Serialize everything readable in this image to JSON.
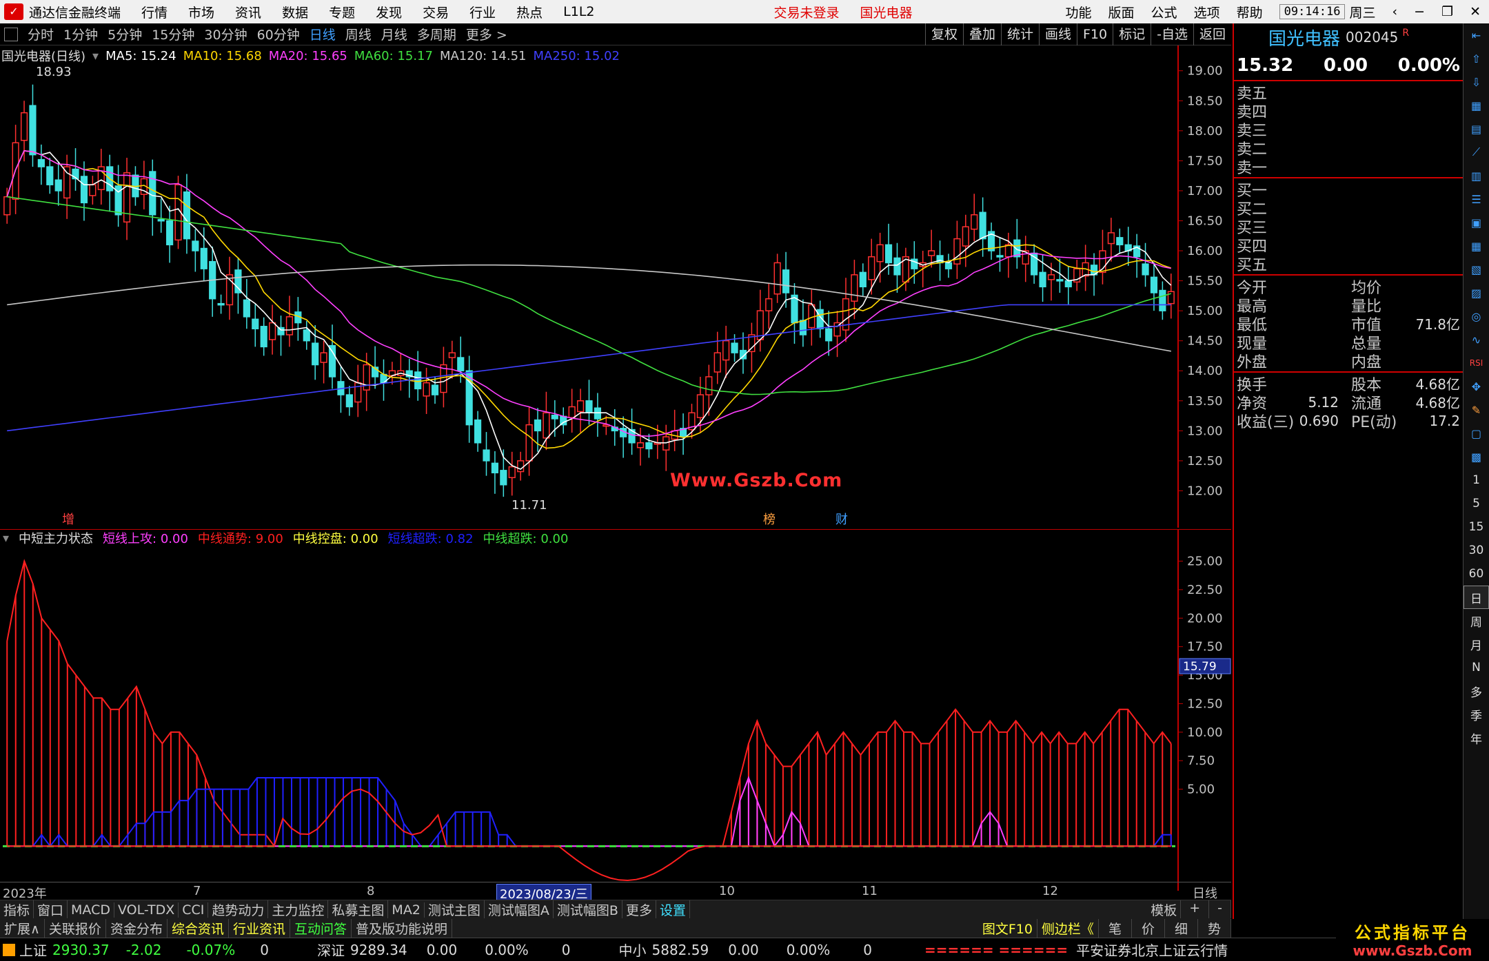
{
  "menubar": {
    "app_title": "通达信金融终端",
    "items": [
      "行情",
      "市场",
      "资讯",
      "数据",
      "专题",
      "发现",
      "交易",
      "行业",
      "热点",
      "L1L2"
    ],
    "trade_status": "交易未登录",
    "stock_name": "国光电器",
    "sys_items": [
      "功能",
      "版面",
      "公式",
      "选项",
      "帮助"
    ],
    "time": "09:14:16",
    "weekday": "周三"
  },
  "periods": [
    "分时",
    "1分钟",
    "5分钟",
    "15分钟",
    "30分钟",
    "60分钟",
    "日线",
    "周线",
    "月线",
    "多周期",
    "更多 >"
  ],
  "active_period": "日线",
  "chart_tools": [
    "复权",
    "叠加",
    "统计",
    "画线",
    "F10",
    "标记",
    "-自选",
    "返回"
  ],
  "ma_info": {
    "title": "国光电器(日线)",
    "ma5": "MA5: 15.24",
    "ma10": "MA10: 15.68",
    "ma20": "MA20: 15.65",
    "ma60": "MA60: 15.17",
    "ma120": "MA120: 14.51",
    "ma250": "MA250: 15.02"
  },
  "indicator_info": {
    "name": "中短主力状态",
    "f1": "短线上攻: 0.00",
    "f2": "中线通势: 9.00",
    "f3": "中线控盘: 0.00",
    "f4": "短线超跌: 0.82",
    "f5": "中线超跌: 0.00"
  },
  "chart_data": [
    {
      "type": "candlestick",
      "title": "国光电器(日线)",
      "y_ticks": [
        "19.00",
        "18.50",
        "18.00",
        "17.50",
        "17.00",
        "16.50",
        "16.00",
        "15.50",
        "15.00",
        "14.50",
        "14.00",
        "13.50",
        "13.00",
        "12.50",
        "12.00"
      ],
      "ylim": [
        11.5,
        19.1
      ],
      "high_label": "18.93",
      "low_label": "11.71",
      "closes": [
        16.9,
        17.8,
        18.3,
        17.6,
        17.4,
        17.1,
        17.0,
        17.4,
        17.2,
        16.8,
        17.1,
        17.4,
        17.0,
        16.6,
        17.3,
        16.9,
        17.2,
        16.6,
        16.5,
        16.1,
        17.1,
        16.2,
        16.0,
        15.7,
        15.2,
        15.1,
        15.6,
        15.3,
        14.9,
        14.7,
        14.4,
        14.8,
        14.6,
        14.9,
        14.8,
        14.5,
        14.1,
        14.3,
        13.9,
        13.6,
        13.4,
        13.8,
        14.1,
        13.9,
        13.8,
        14.0,
        14.0,
        13.9,
        13.7,
        13.8,
        13.6,
        14.1,
        14.3,
        14.0,
        13.1,
        12.8,
        12.5,
        12.3,
        12.1,
        12.4,
        12.5,
        13.1,
        13.0,
        13.3,
        13.2,
        13.1,
        13.4,
        13.5,
        13.3,
        13.2,
        13.1,
        13.0,
        12.9,
        12.8,
        12.8,
        12.7,
        12.8,
        12.9,
        13.0,
        12.9,
        13.3,
        13.6,
        13.9,
        14.3,
        14.5,
        14.3,
        14.2,
        14.6,
        15.0,
        15.2,
        15.8,
        15.3,
        14.8,
        14.6,
        15.1,
        14.7,
        14.5,
        14.8,
        15.2,
        15.6,
        15.4,
        15.9,
        16.1,
        15.8,
        15.6,
        15.9,
        15.7,
        15.8,
        16.0,
        15.8,
        15.7,
        16.2,
        16.4,
        16.6,
        16.2,
        16.0,
        15.9,
        16.1,
        15.9,
        16.0,
        15.6,
        15.4,
        15.6,
        15.5,
        15.4,
        15.7,
        15.8,
        15.6,
        16.0,
        16.3,
        16.1,
        16.0,
        15.9,
        15.6,
        15.3,
        15.0,
        15.32
      ],
      "ma_lines": [
        {
          "name": "MA5",
          "color": "#ffffff"
        },
        {
          "name": "MA10",
          "color": "#ffd700"
        },
        {
          "name": "MA20",
          "color": "#ff40ff"
        },
        {
          "name": "MA60",
          "color": "#40e040"
        },
        {
          "name": "MA120",
          "color": "#c8c8c8"
        },
        {
          "name": "MA250",
          "color": "#4040ff"
        }
      ]
    },
    {
      "type": "bar",
      "title": "中短主力状态",
      "y_ticks": [
        "25.00",
        "22.50",
        "20.00",
        "17.50",
        "15.00",
        "12.50",
        "10.00",
        "7.50",
        "5.00"
      ],
      "ylim": [
        -3,
        26
      ],
      "marker_value": "15.79",
      "series": [
        {
          "name": "中线通势",
          "color": "#ff2020",
          "values": [
            18,
            22,
            25,
            23,
            20,
            19,
            18,
            16,
            15,
            14,
            13,
            13,
            12,
            12,
            13,
            14,
            12,
            10,
            9,
            10,
            10,
            9,
            8,
            6,
            4,
            3,
            2,
            1,
            1,
            1,
            1,
            0,
            0,
            0,
            0,
            0,
            0,
            0,
            0,
            0,
            0,
            0,
            0,
            0,
            0,
            0,
            0,
            0,
            0,
            0,
            0,
            0,
            0,
            0,
            0,
            0,
            0,
            0,
            0,
            0,
            0,
            0,
            0,
            0,
            0,
            0,
            0,
            0,
            0,
            0,
            0,
            0,
            0,
            0,
            0,
            0,
            0,
            0,
            0,
            0,
            0,
            0,
            0,
            0,
            3,
            6,
            9,
            11,
            9,
            8,
            7,
            7,
            8,
            9,
            10,
            8,
            9,
            10,
            9,
            8,
            9,
            10,
            10,
            11,
            10,
            10,
            9,
            9,
            10,
            11,
            12,
            11,
            10,
            10,
            11,
            10,
            10,
            11,
            10,
            9,
            10,
            9,
            10,
            9,
            9,
            10,
            9,
            10,
            11,
            12,
            12,
            11,
            10,
            9,
            10,
            9
          ]
        },
        {
          "name": "中线控盘",
          "color": "#2020ff",
          "values": [
            0,
            0,
            0,
            0,
            1,
            0,
            1,
            0,
            0,
            0,
            0,
            1,
            0,
            0,
            1,
            2,
            2,
            3,
            3,
            3,
            4,
            4,
            5,
            5,
            5,
            5,
            5,
            5,
            5,
            6,
            6,
            6,
            6,
            6,
            6,
            6,
            6,
            6,
            6,
            6,
            6,
            6,
            6,
            6,
            5,
            4,
            2,
            1,
            0,
            0,
            1,
            2,
            3,
            3,
            3,
            3,
            3,
            1,
            1,
            0,
            0,
            0,
            0,
            0,
            0,
            0,
            0,
            0,
            0,
            0,
            0,
            0,
            0,
            0,
            0,
            0,
            0,
            0,
            0,
            0,
            0,
            0,
            0,
            0,
            0,
            0,
            0,
            0,
            0,
            0,
            0,
            0,
            0,
            0,
            0,
            0,
            0,
            0,
            0,
            0,
            0,
            0,
            0,
            0,
            0,
            0,
            0,
            0,
            0,
            0,
            0,
            0,
            0,
            0,
            0,
            0,
            0,
            0,
            0,
            0,
            0,
            0,
            0,
            0,
            0,
            0,
            0,
            0,
            0,
            0,
            0,
            0,
            0,
            0,
            1,
            1
          ]
        },
        {
          "name": "短线上攻",
          "color": "#ff40ff",
          "values": [
            0,
            0,
            0,
            0,
            0,
            0,
            0,
            0,
            0,
            0,
            0,
            0,
            0,
            0,
            0,
            0,
            0,
            0,
            0,
            0,
            0,
            0,
            0,
            0,
            0,
            0,
            0,
            0,
            0,
            0,
            0,
            0,
            0,
            0,
            0,
            0,
            0,
            0,
            0,
            0,
            0,
            0,
            0,
            0,
            0,
            0,
            0,
            0,
            0,
            0,
            0,
            0,
            0,
            0,
            0,
            0,
            0,
            0,
            0,
            0,
            0,
            0,
            0,
            0,
            0,
            0,
            0,
            0,
            0,
            0,
            0,
            0,
            0,
            0,
            0,
            0,
            0,
            0,
            0,
            0,
            0,
            0,
            0,
            0,
            0,
            4,
            6,
            4,
            2,
            0,
            1,
            3,
            2,
            0,
            0,
            0,
            0,
            0,
            0,
            0,
            0,
            0,
            0,
            0,
            0,
            0,
            0,
            0,
            0,
            0,
            0,
            0,
            0,
            2,
            3,
            2,
            0,
            0,
            0,
            0,
            0,
            0,
            0,
            0,
            0,
            0,
            0,
            0,
            0,
            0,
            0,
            0,
            0,
            0,
            0,
            0
          ]
        }
      ],
      "x_ticks": [
        "2023年",
        "7",
        "8",
        "2023/08/23/三",
        "10",
        "11",
        "12"
      ],
      "x_axis_right": "日线"
    }
  ],
  "watermark": "Www.Gszb.Com",
  "markers": {
    "zeng": "增",
    "bang": "榜",
    "cai": "财"
  },
  "tabs1": [
    "指标",
    "窗口",
    "MACD",
    "VOL-TDX",
    "CCI",
    "趋势动力",
    "主力监控",
    "私募主图",
    "MA2",
    "测试主图",
    "测试幅图A",
    "测试幅图B",
    "更多",
    "设置"
  ],
  "tabs1_right": [
    "模板",
    "+",
    "-"
  ],
  "tabs2": [
    "扩展∧",
    "关联报价",
    "资金分布",
    "综合资讯",
    "行业资讯",
    "互动问答",
    "普及版功能说明"
  ],
  "tabs2_right": [
    "图文F10",
    "侧边栏《",
    "笔",
    "价",
    "细",
    "势"
  ],
  "status": {
    "sh_label": "上证",
    "sh_val": "2930.37",
    "sh_chg": "-2.02",
    "sh_pct": "-0.07%",
    "sz_label": "深证",
    "sz_val": "9289.34",
    "sz_chg": "0.00",
    "sz_pct": "0.00%",
    "sz_vol": "0",
    "zx_label": "中小",
    "zx_val": "5882.59",
    "zx_chg": "0.00",
    "zx_pct": "0.00%",
    "zx_vol": "0",
    "sh_vol": "0",
    "marquee": "====== ======",
    "provider": "平安证券北京上证云行情"
  },
  "quote": {
    "name": "国光电器",
    "code": "002045",
    "flag": "R",
    "price": "15.32",
    "change": "0.00",
    "pct": "0.00%",
    "sell": [
      "卖五",
      "卖四",
      "卖三",
      "卖二",
      "卖一"
    ],
    "buy": [
      "买一",
      "买二",
      "买三",
      "买四",
      "买五"
    ],
    "stats": [
      {
        "l1": "今开",
        "v1": "",
        "l2": "均价",
        "v2": ""
      },
      {
        "l1": "最高",
        "v1": "",
        "l2": "量比",
        "v2": ""
      },
      {
        "l1": "最低",
        "v1": "",
        "l2": "市值",
        "v2": "71.8亿"
      },
      {
        "l1": "现量",
        "v1": "",
        "l2": "总量",
        "v2": ""
      },
      {
        "l1": "外盘",
        "v1": "",
        "l2": "内盘",
        "v2": ""
      }
    ],
    "stats2": [
      {
        "l1": "换手",
        "v1": "",
        "l2": "股本",
        "v2": "4.68亿"
      },
      {
        "l1": "净资",
        "v1": "5.12",
        "l2": "流通",
        "v2": "4.68亿"
      },
      {
        "l1": "收益(三)",
        "v1": "0.690",
        "l2": "PE(动)",
        "v2": "17.2"
      }
    ]
  },
  "sidebar": [
    "1",
    "5",
    "15",
    "30",
    "60",
    "日",
    "周",
    "月",
    "N",
    "多",
    "季",
    "年"
  ],
  "badge": {
    "line1": "公式指标平台",
    "line2": "www.Gszb.Com"
  }
}
